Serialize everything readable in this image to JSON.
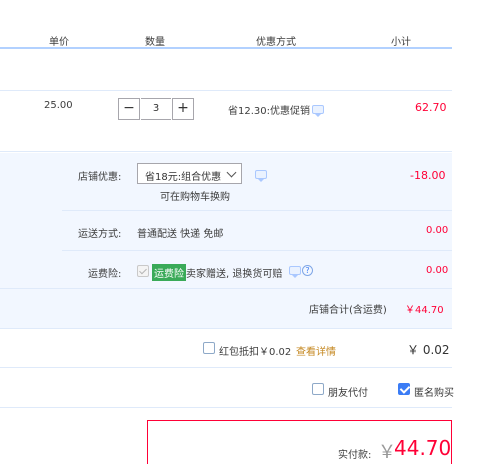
{
  "table_header": {
    "unit_price": "单价",
    "quantity": "数量",
    "promotion": "优惠方式",
    "subtotal": "小计"
  },
  "item": {
    "unit_price": "25.00",
    "quantity": "3",
    "minus": "−",
    "plus": "+",
    "promo_text": "省12.30:优惠促销",
    "subtotal": "62.70"
  },
  "shop": {
    "discount_label": "店铺优惠:",
    "discount_select": "省18元:组合优惠",
    "discount_hint": "可在购物车换购",
    "discount_amount": "-18.00",
    "shipping_label": "运送方式:",
    "shipping_value": "普通配送 快递 免邮",
    "shipping_amount": "0.00",
    "insurance_label": "运费险:",
    "insurance_tag": "运费险",
    "insurance_desc": "卖家赠送, 退换货可赔",
    "insurance_amount": "0.00",
    "total_label": "店铺合计(含运费)",
    "total_value": "￥44.70"
  },
  "redpacket": {
    "label": "红包抵扣￥0.02",
    "link": "查看详情",
    "amount": "￥ 0.02"
  },
  "options": {
    "friend_pay": "朋友代付",
    "anonymous": "匿名购买"
  },
  "payment": {
    "label": "实付款:",
    "currency": "￥",
    "amount": "44.70"
  },
  "icons": {
    "chat": "chat-bubble-icon",
    "help": "question-circle-icon",
    "dropdown": "chevron-down-icon"
  },
  "colors": {
    "accent_red": "#ff0036",
    "header_border": "#b2d1ff",
    "band_bg": "#f2f7ff",
    "insurance_green": "#3aaa58",
    "checkbox_blue": "#3b7cf5"
  }
}
